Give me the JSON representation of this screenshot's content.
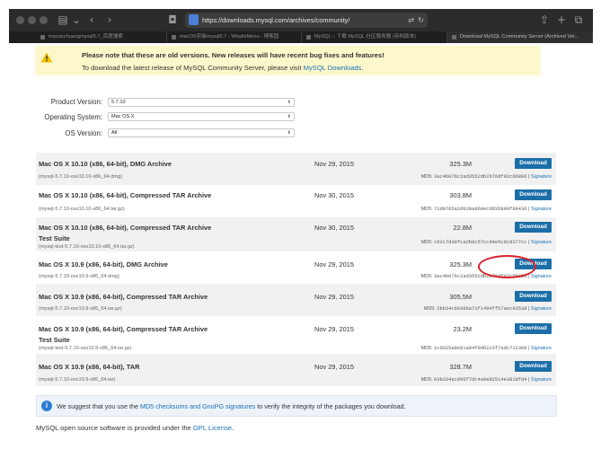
{
  "browser": {
    "url": "https://downloads.mysql.com/archives/community/",
    "tabs": [
      {
        "label": "macanzhuangmysql5.7_百度搜索",
        "active": false
      },
      {
        "label": "macOS安装mysql5.7 - WhatIsMenu - 博客园",
        "active": false
      },
      {
        "label": "MySQL :: 下载 MySQL 社区服务器 (存档版本)",
        "active": false
      },
      {
        "label": "Download MySQL Community Server (Archived Ver...",
        "active": true
      }
    ]
  },
  "notice": {
    "title": "Please note that these are old versions. New releases will have recent bug fixes and features!",
    "line2_prefix": "To download the latest release of MySQL Community Server, please visit ",
    "line2_link": "MySQL Downloads",
    "line2_suffix": "."
  },
  "filters": {
    "product_version": {
      "label": "Product Version:",
      "value": "5.7.10"
    },
    "operating_system": {
      "label": "Operating System:",
      "value": "Mac OS X"
    },
    "os_version": {
      "label": "OS Version:",
      "value": "All"
    }
  },
  "downloads": {
    "button_label": "Download",
    "signature_label": "Signature",
    "md5_prefix": "MD5: ",
    "separator": " | ",
    "rows": [
      {
        "title": "Mac OS X 10.10 (x86, 64-bit), DMG Archive",
        "title2": "",
        "file": "(mysql-5.7.10-osx10.10-x86_64.dmg)",
        "date": "Nov 29, 2015",
        "size": "325.3M",
        "md5": "3ac4b076c2ad3552db2b76df02c6b896"
      },
      {
        "title": "Mac OS X 10.10 (x86, 64-bit), Compressed TAR Archive",
        "title2": "",
        "file": "(mysql-5.7.10-osx10.10-x86_64.tar.gz)",
        "date": "Nov 30, 2015",
        "size": "303.8M",
        "md5": "71d0705a2d628a869ecdd35809f89436"
      },
      {
        "title": "Mac OS X 10.10 (x86, 64-bit), Compressed TAR Archive",
        "title2": "Test Suite",
        "file": "(mysql-test-5.7.10-osx10.10-x86_64.tar.gz)",
        "date": "Nov 30, 2015",
        "size": "22.8M",
        "md5": "c62c7d38fca2b8c57ccd4e5c9c9377cc"
      },
      {
        "title": "Mac OS X 10.9 (x86, 64-bit), DMG Archive",
        "title2": "",
        "file": "(mysql-5.7.10-osx10.9-x86_64.dmg)",
        "date": "Nov 29, 2015",
        "size": "325.3M",
        "md5": "3ac4b076c2ad3552db2b76df02c6b896"
      },
      {
        "title": "Mac OS X 10.9 (x86, 64-bit), Compressed TAR Archive",
        "title2": "",
        "file": "(mysql-5.7.10-osx10.9-x86_64.tar.gz)",
        "date": "Nov 29, 2015",
        "size": "305.5M",
        "md5": "2bb34c6036ba71f1494ff57aec9353d"
      },
      {
        "title": "Mac OS X 10.9 (x86, 64-bit), Compressed TAR Archive",
        "title2": "Test Suite",
        "file": "(mysql-test-5.7.10-osx10.9-x86_64.tar.gz)",
        "date": "Nov 29, 2015",
        "size": "23.2M",
        "md5": "1c6625a8e61a04f9d6223f7adc712360"
      },
      {
        "title": "Mac OS X 10.9 (x86, 64-bit), TAR",
        "title2": "",
        "file": "(mysql-5.7.10-osx10.9-x86_64.tar)",
        "date": "Nov 29, 2015",
        "size": "328.7M",
        "md5": "03b334ac895f7dc4a9e82514e3818fd4"
      }
    ]
  },
  "info": {
    "prefix": "We suggest that you use the ",
    "link": "MD5 checksums and GnuPG signatures",
    "suffix": " to verify the integrity of the packages you download."
  },
  "footer": {
    "prefix": "MySQL open source software is provided under the ",
    "link": "GPL License",
    "suffix": "."
  },
  "colors": {
    "download_button": "#1b6ea8",
    "link": "#1a6fb3",
    "highlight_circle": "#d8202a",
    "notice_bg": "#fdf8cc"
  }
}
